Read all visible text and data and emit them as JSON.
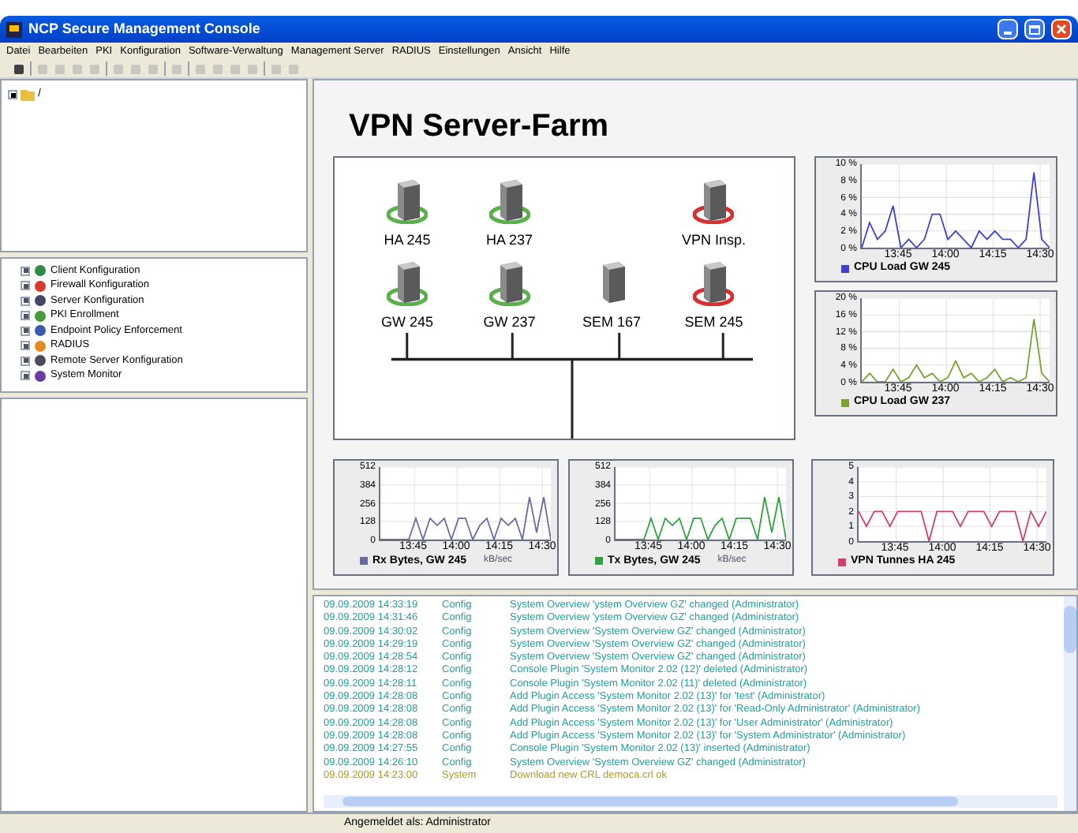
{
  "window": {
    "title": "NCP Secure Management Console"
  },
  "menu": [
    "Datei",
    "Bearbeiten",
    "PKI",
    "Konfiguration",
    "Software-Verwaltung",
    "Management Server",
    "RADIUS",
    "Einstellungen",
    "Ansicht",
    "Hilfe"
  ],
  "toolbar": [
    {
      "kind": "button",
      "disabled": false
    },
    {
      "kind": "separator"
    },
    {
      "kind": "button",
      "disabled": true
    },
    {
      "kind": "button",
      "disabled": true
    },
    {
      "kind": "button",
      "disabled": true
    },
    {
      "kind": "button",
      "disabled": true
    },
    {
      "kind": "separator"
    },
    {
      "kind": "button",
      "disabled": true
    },
    {
      "kind": "button",
      "disabled": true
    },
    {
      "kind": "button",
      "disabled": true
    },
    {
      "kind": "separator"
    },
    {
      "kind": "button",
      "disabled": true
    },
    {
      "kind": "separator"
    },
    {
      "kind": "button",
      "disabled": true
    },
    {
      "kind": "button",
      "disabled": true
    },
    {
      "kind": "button",
      "disabled": true
    },
    {
      "kind": "button",
      "disabled": true
    },
    {
      "kind": "separator"
    },
    {
      "kind": "button",
      "disabled": true
    },
    {
      "kind": "button",
      "disabled": true
    }
  ],
  "root_tree": {
    "label": "/",
    "expanded": false
  },
  "tree": [
    {
      "label": "Client Konfiguration",
      "color": "#2f8a4a"
    },
    {
      "label": "Firewall Konfiguration",
      "color": "#d83a2a"
    },
    {
      "label": "Server Konfiguration",
      "color": "#444466"
    },
    {
      "label": "PKI Enrollment",
      "color": "#4a9a3a"
    },
    {
      "label": "Endpoint Policy Enforcement",
      "color": "#3a5ab0"
    },
    {
      "label": "RADIUS",
      "color": "#e08a20"
    },
    {
      "label": "Remote Server Konfiguration",
      "color": "#4a4a5a"
    },
    {
      "label": "System Monitor",
      "color": "#6a3aa0"
    }
  ],
  "page_title": "VPN Server-Farm",
  "servers": [
    {
      "kind": "server",
      "name": "HA 245",
      "color": "#5ab04a"
    },
    {
      "kind": "server",
      "name": "HA 237",
      "color": "#5ab04a"
    },
    {
      "kind": "empty"
    },
    {
      "kind": "server",
      "name": "VPN Insp.",
      "color": "#d83030"
    },
    {
      "kind": "server",
      "name": "GW 245",
      "color": "#5ab04a"
    },
    {
      "kind": "server",
      "name": "GW 237",
      "color": "#5ab04a"
    },
    {
      "kind": "server",
      "name": "SEM 167"
    },
    {
      "kind": "server",
      "name": "SEM 245",
      "color": "#d83030"
    }
  ],
  "side_charts": [
    {
      "chart_data": {
        "type": "line",
        "x": [
          813,
          815.5,
          818,
          820.5,
          823,
          825.5,
          828,
          830.5,
          833,
          835.5,
          838,
          840.5,
          843,
          845.5,
          848,
          850.5,
          853,
          855.5,
          858,
          860.5,
          863,
          865.5,
          868,
          870.5,
          873
        ],
        "xlim": [
          813,
          873
        ],
        "ylim": [
          0,
          10
        ],
        "grid": true,
        "xticks": [
          {
            "value": 825,
            "label": "13:45"
          },
          {
            "value": 840,
            "label": "14:00"
          },
          {
            "value": 855,
            "label": "14:15"
          },
          {
            "value": 870,
            "label": "14:30"
          }
        ],
        "yticks": [
          {
            "value": 10,
            "label": "10 %"
          },
          {
            "value": 8,
            "label": "8 %"
          },
          {
            "value": 6,
            "label": "6 %"
          },
          {
            "value": 4,
            "label": "4 %"
          },
          {
            "value": 2,
            "label": "2 %"
          },
          {
            "value": 0,
            "label": "0 %"
          }
        ],
        "series": [
          {
            "name": "CPU Load GW 245",
            "color": "#4040d0",
            "values": [
              0,
              3,
              1,
              2,
              5,
              0,
              1,
              0,
              1,
              4,
              4,
              1,
              2,
              1,
              0,
              2,
              1,
              2,
              1,
              1,
              0,
              1,
              9,
              1,
              0
            ]
          }
        ]
      }
    },
    {
      "chart_data": {
        "type": "line",
        "x": [
          813,
          815.5,
          818,
          820.5,
          823,
          825.5,
          828,
          830.5,
          833,
          835.5,
          838,
          840.5,
          843,
          845.5,
          848,
          850.5,
          853,
          855.5,
          858,
          860.5,
          863,
          865.5,
          868,
          870.5,
          873
        ],
        "xlim": [
          813,
          873
        ],
        "ylim": [
          0,
          20
        ],
        "grid": true,
        "xticks": [
          {
            "value": 825,
            "label": "13:45"
          },
          {
            "value": 840,
            "label": "14:00"
          },
          {
            "value": 855,
            "label": "14:15"
          },
          {
            "value": 870,
            "label": "14:30"
          }
        ],
        "yticks": [
          {
            "value": 20,
            "label": "20 %"
          },
          {
            "value": 16,
            "label": "16 %"
          },
          {
            "value": 12,
            "label": "12 %"
          },
          {
            "value": 8,
            "label": "8 %"
          },
          {
            "value": 4,
            "label": "4 %"
          },
          {
            "value": 0,
            "label": "0 %"
          }
        ],
        "series": [
          {
            "name": "CPU Load GW 237",
            "color": "#7aa030",
            "values": [
              0,
              2,
              0,
              0,
              3,
              0,
              1,
              4,
              1,
              2,
              0,
              1,
              5,
              1,
              2,
              0,
              1,
              3,
              0,
              1,
              0,
              1,
              15,
              2,
              0
            ]
          }
        ]
      }
    }
  ],
  "bottom_charts": [
    {
      "unit": "kB/sec",
      "chart_data": {
        "type": "line",
        "grid": true,
        "x": [
          813,
          815.5,
          818,
          820.5,
          823,
          825.5,
          828,
          830.5,
          833,
          835.5,
          838,
          840.5,
          843,
          845.5,
          848,
          850.5,
          853,
          855.5,
          858,
          860.5,
          863,
          865.5,
          868,
          870.5,
          873
        ],
        "xlim": [
          813,
          873
        ],
        "ylim": [
          0,
          512
        ],
        "xticks": [
          {
            "value": 825,
            "label": "13:45"
          },
          {
            "value": 840,
            "label": "14:00"
          },
          {
            "value": 855,
            "label": "14:15"
          },
          {
            "value": 870,
            "label": "14:30"
          }
        ],
        "yticks": [
          {
            "value": 512,
            "label": "512"
          },
          {
            "value": 384,
            "label": "384"
          },
          {
            "value": 256,
            "label": "256"
          },
          {
            "value": 128,
            "label": "128"
          },
          {
            "value": 0,
            "label": "0"
          }
        ],
        "series": [
          {
            "name": "Rx Bytes, GW 245",
            "color": "#6a6aa0",
            "values": [
              0,
              0,
              0,
              0,
              0,
              150,
              0,
              150,
              100,
              150,
              0,
              150,
              150,
              0,
              100,
              150,
              0,
              150,
              100,
              150,
              0,
              300,
              50,
              300,
              0
            ]
          }
        ]
      }
    },
    {
      "unit": "kB/sec",
      "chart_data": {
        "type": "line",
        "grid": true,
        "x": [
          813,
          815.5,
          818,
          820.5,
          823,
          825.5,
          828,
          830.5,
          833,
          835.5,
          838,
          840.5,
          843,
          845.5,
          848,
          850.5,
          853,
          855.5,
          858,
          860.5,
          863,
          865.5,
          868,
          870.5,
          873
        ],
        "xlim": [
          813,
          873
        ],
        "ylim": [
          0,
          512
        ],
        "xticks": [
          {
            "value": 825,
            "label": "13:45"
          },
          {
            "value": 840,
            "label": "14:00"
          },
          {
            "value": 855,
            "label": "14:15"
          },
          {
            "value": 870,
            "label": "14:30"
          }
        ],
        "yticks": [
          {
            "value": 512,
            "label": "512"
          },
          {
            "value": 384,
            "label": "384"
          },
          {
            "value": 256,
            "label": "256"
          },
          {
            "value": 128,
            "label": "128"
          },
          {
            "value": 0,
            "label": "0"
          }
        ],
        "series": [
          {
            "name": "Tx Bytes, GW 245",
            "color": "#30a040",
            "values": [
              0,
              0,
              0,
              0,
              0,
              150,
              0,
              150,
              100,
              150,
              0,
              150,
              150,
              0,
              100,
              150,
              0,
              150,
              150,
              150,
              0,
              300,
              50,
              300,
              0
            ]
          }
        ]
      }
    },
    {
      "chart_data": {
        "type": "line",
        "x": [
          813,
          815.5,
          818,
          820.5,
          823,
          825.5,
          828,
          830.5,
          833,
          835.5,
          838,
          840.5,
          843,
          845.5,
          848,
          850.5,
          853,
          855.5,
          858,
          860.5,
          863,
          865.5,
          868,
          870.5,
          873
        ],
        "xlim": [
          813,
          873
        ],
        "ylim": [
          0,
          5
        ],
        "grid": true,
        "xticks": [
          {
            "value": 825,
            "label": "13:45"
          },
          {
            "value": 840,
            "label": "14:00"
          },
          {
            "value": 855,
            "label": "14:15"
          },
          {
            "value": 870,
            "label": "14:30"
          }
        ],
        "yticks": [
          {
            "value": 5,
            "label": "5"
          },
          {
            "value": 4,
            "label": "4"
          },
          {
            "value": 3,
            "label": "3"
          },
          {
            "value": 2,
            "label": "2"
          },
          {
            "value": 1,
            "label": "1"
          },
          {
            "value": 0,
            "label": "0"
          }
        ],
        "series": [
          {
            "name": "VPN Tunnes HA 245",
            "color": "#d04070",
            "values": [
              2,
              1,
              2,
              2,
              1,
              2,
              2,
              2,
              2,
              0,
              2,
              2,
              2,
              1,
              2,
              2,
              2,
              1,
              2,
              2,
              2,
              0,
              2,
              1,
              2
            ]
          }
        ]
      }
    }
  ],
  "log": [
    {
      "time": "09.09.2009 14:33:19",
      "type": "Config",
      "message": "System Overview 'ystem Overview GZ' changed (Administrator)"
    },
    {
      "time": "09.09.2009 14:31:46",
      "type": "Config",
      "message": "System Overview 'ystem Overview GZ' changed (Administrator)"
    },
    {
      "time": "09.09.2009 14:30:02",
      "type": "Config",
      "message": "System Overview 'System Overview GZ' changed (Administrator)"
    },
    {
      "time": "09.09.2009 14:29:19",
      "type": "Config",
      "message": "System Overview 'System Overview GZ' changed (Administrator)"
    },
    {
      "time": "09.09.2009 14:28:54",
      "type": "Config",
      "message": "System Overview 'System Overview GZ' changed (Administrator)"
    },
    {
      "time": "09.09.2009 14:28:12",
      "type": "Config",
      "message": "Console Plugin 'System Monitor 2.02 (12)' deleted (Administrator)"
    },
    {
      "time": "09.09.2009 14:28:11",
      "type": "Config",
      "message": "Console Plugin 'System Monitor 2.02 (11)' deleted (Administrator)"
    },
    {
      "time": "09.09.2009 14:28:08",
      "type": "Config",
      "message": "Add Plugin Access 'System Monitor 2.02 (13)' for 'test' (Administrator)"
    },
    {
      "time": "09.09.2009 14:28:08",
      "type": "Config",
      "message": "Add Plugin Access 'System Monitor 2.02 (13)' for 'Read-Only Administrator' (Administrator)"
    },
    {
      "time": "09.09.2009 14:28:08",
      "type": "Config",
      "message": "Add Plugin Access 'System Monitor 2.02 (13)' for 'User Administrator' (Administrator)"
    },
    {
      "time": "09.09.2009 14:28:08",
      "type": "Config",
      "message": "Add Plugin Access 'System Monitor 2.02 (13)' for 'System Administrator' (Administrator)"
    },
    {
      "time": "09.09.2009 14:27:55",
      "type": "Config",
      "message": "Console Plugin 'System Monitor 2.02 (13)' inserted (Administrator)"
    },
    {
      "time": "09.09.2009 14:26:10",
      "type": "Config",
      "message": "System Overview 'System Overview GZ' changed (Administrator)"
    },
    {
      "time": "09.09.2009 14:23:00",
      "type": "System",
      "message": "Download new CRL democa.crl ok"
    }
  ],
  "status_bar": "Angemeldet als: Administrator"
}
